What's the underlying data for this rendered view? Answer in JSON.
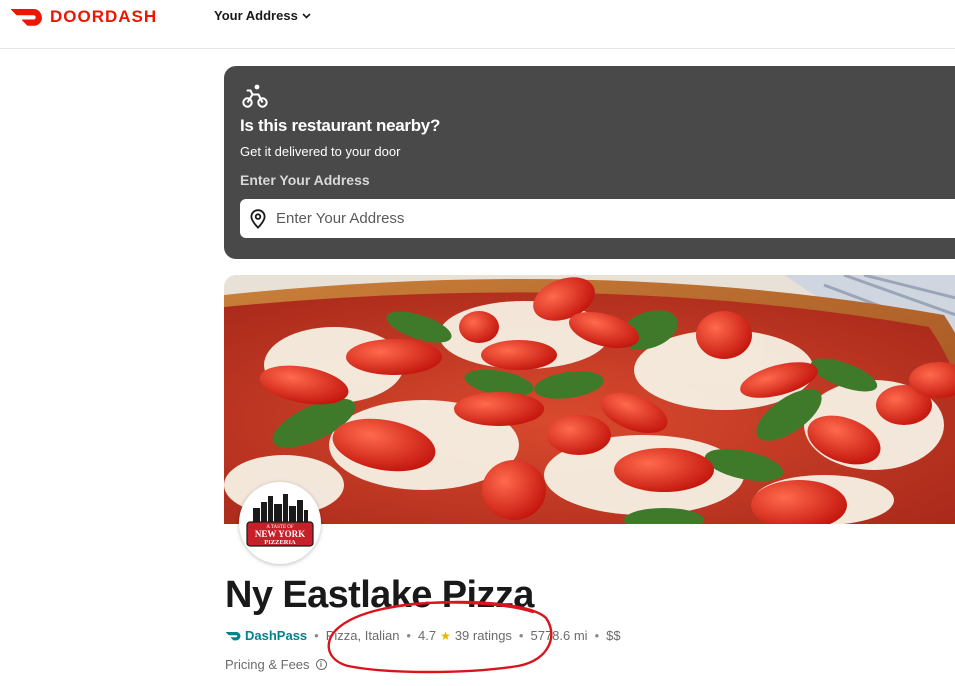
{
  "header": {
    "brand": "DOORDASH",
    "address_label": "Your Address",
    "brand_color": "#eb1700"
  },
  "nearby": {
    "title": "Is this restaurant nearby?",
    "subtitle": "Get it delivered to your door",
    "field_label": "Enter Your Address",
    "input_placeholder": "Enter Your Address",
    "input_value": "",
    "card_color": "#494949"
  },
  "store": {
    "name": "Ny Eastlake Pizza",
    "logo_text_top": "A TASTE OF",
    "logo_text_main": "NEW YORK",
    "logo_text_sub": "PIZZERIA",
    "dashpass_label": "DashPass",
    "cuisine": "Pizza, Italian",
    "rating": "4.7",
    "ratings_count": "39 ratings",
    "distance": "5778.6 mi",
    "price_range": "$$",
    "pricing_label": "Pricing & Fees",
    "dashpass_color": "#00838a"
  },
  "icons": {
    "brand": "doordash-logo-icon",
    "chevron": "chevron-down-icon",
    "scooter": "scooter-icon",
    "pin": "location-pin-icon",
    "dashpass": "dashpass-icon",
    "star": "star-icon",
    "info": "info-icon"
  }
}
